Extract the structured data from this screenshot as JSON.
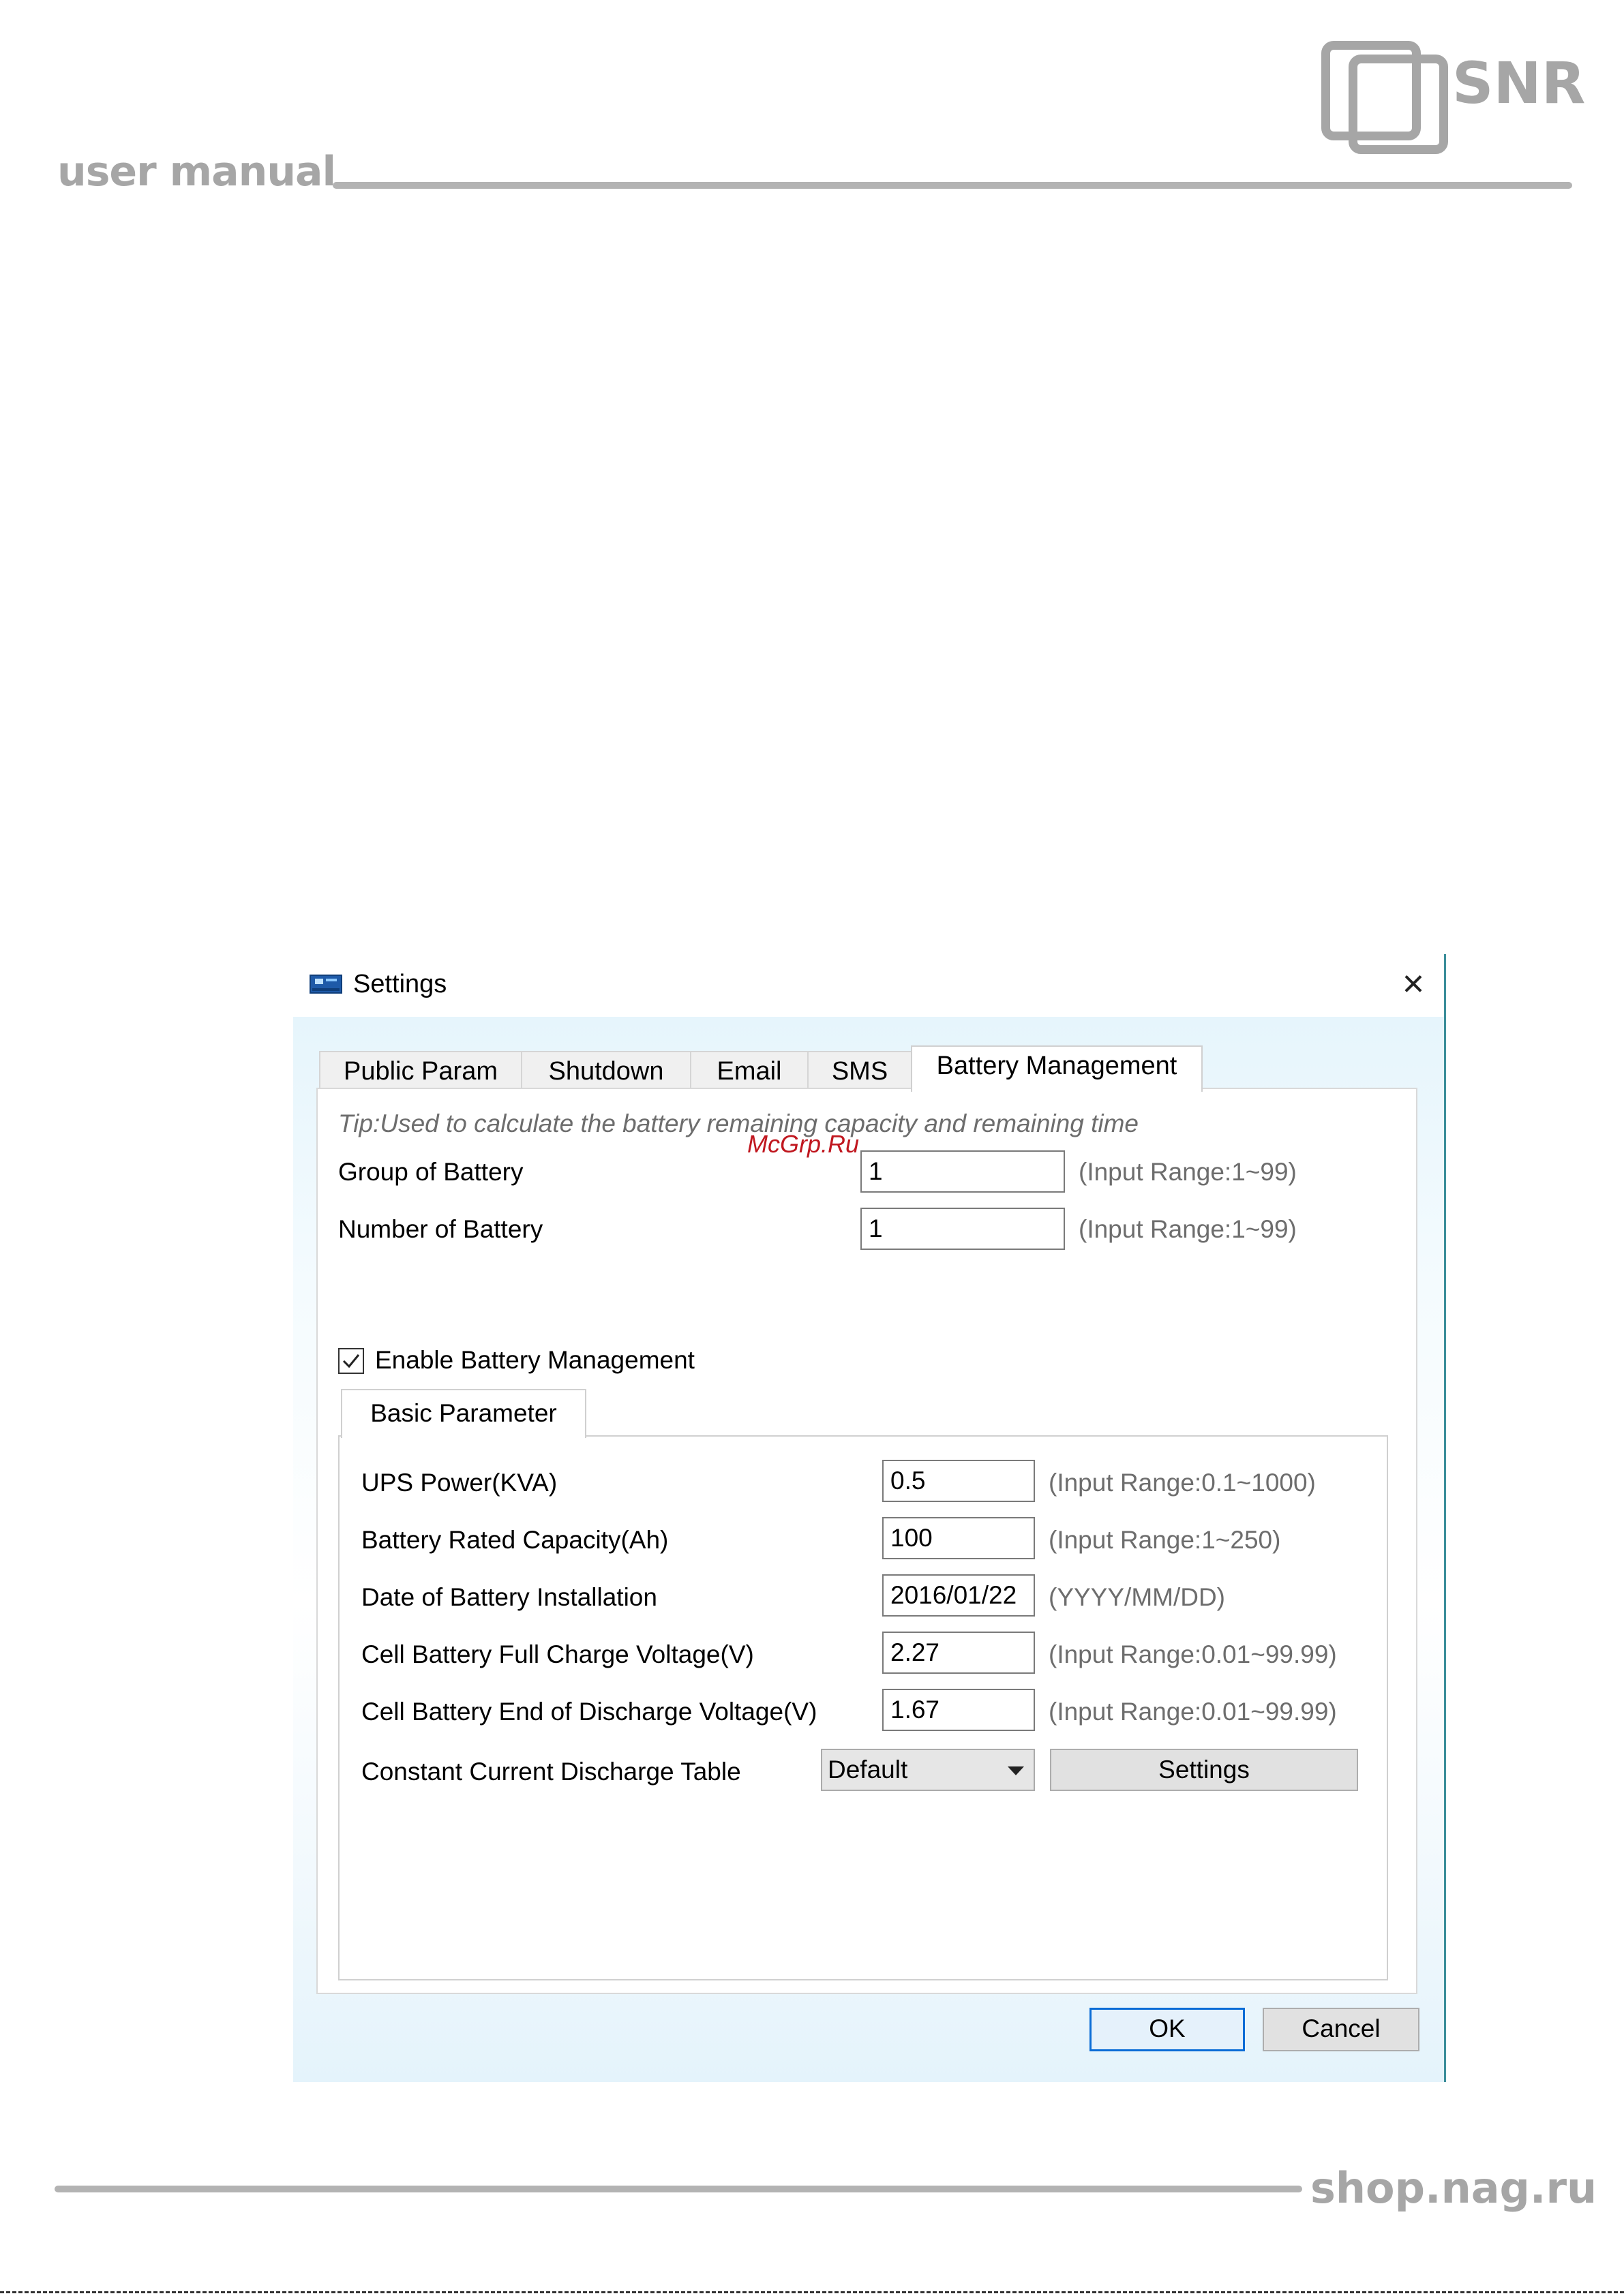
{
  "page": {
    "header_title": "user manual",
    "logo_text": "SNR",
    "footer_text": "shop.nag.ru",
    "watermark": "McGrp.Ru"
  },
  "dialog": {
    "title": "Settings",
    "close_icon": "close-icon",
    "tabs": [
      {
        "label": "Public Param",
        "active": false
      },
      {
        "label": "Shutdown",
        "active": false
      },
      {
        "label": "Email",
        "active": false
      },
      {
        "label": "SMS",
        "active": false
      },
      {
        "label": "Battery Management",
        "active": true
      }
    ],
    "tip": "Tip:Used to calculate the battery remaining capacity and remaining time",
    "group_of_battery": {
      "label": "Group of Battery",
      "value": "1",
      "hint": "(Input Range:1~99)"
    },
    "number_of_battery": {
      "label": "Number of Battery",
      "value": "1",
      "hint": "(Input Range:1~99)"
    },
    "enable_battery_management": {
      "label": "Enable Battery Management",
      "checked": true
    },
    "inner_tab": "Basic Parameter",
    "params": [
      {
        "label": "UPS Power(KVA)",
        "value": "0.5",
        "hint": "(Input Range:0.1~1000)"
      },
      {
        "label": "Battery Rated Capacity(Ah)",
        "value": "100",
        "hint": "(Input Range:1~250)"
      },
      {
        "label": "Date of Battery Installation",
        "value": "2016/01/22",
        "hint": "(YYYY/MM/DD)"
      },
      {
        "label": "Cell Battery Full Charge Voltage(V)",
        "value": "2.27",
        "hint": "(Input Range:0.01~99.99)"
      },
      {
        "label": "Cell Battery End of Discharge Voltage(V)",
        "value": "1.67",
        "hint": "(Input Range:0.01~99.99)"
      }
    ],
    "discharge_table": {
      "label": "Constant Current Discharge Table",
      "selected": "Default",
      "settings_button": "Settings"
    },
    "ok_button": "OK",
    "cancel_button": "Cancel",
    "accent_color": "#0a6cd6"
  }
}
